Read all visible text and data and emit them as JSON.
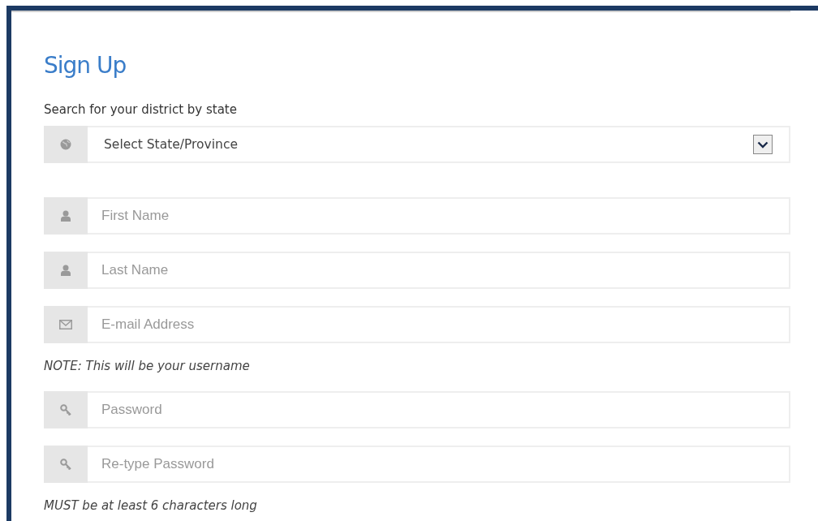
{
  "form": {
    "title": "Sign Up",
    "state_label": "Search for your district by state",
    "state_select": {
      "value": "Select State/Province"
    },
    "fields": [
      {
        "kind": "name",
        "placeholder": "First Name"
      },
      {
        "kind": "name",
        "placeholder": "Last Name"
      },
      {
        "kind": "email",
        "placeholder": "E-mail Address",
        "note": "NOTE: This will be your username"
      },
      {
        "kind": "password",
        "placeholder": "Password"
      },
      {
        "kind": "password",
        "placeholder": "Re-type Password",
        "note": "MUST be at least 6 characters long"
      }
    ]
  }
}
